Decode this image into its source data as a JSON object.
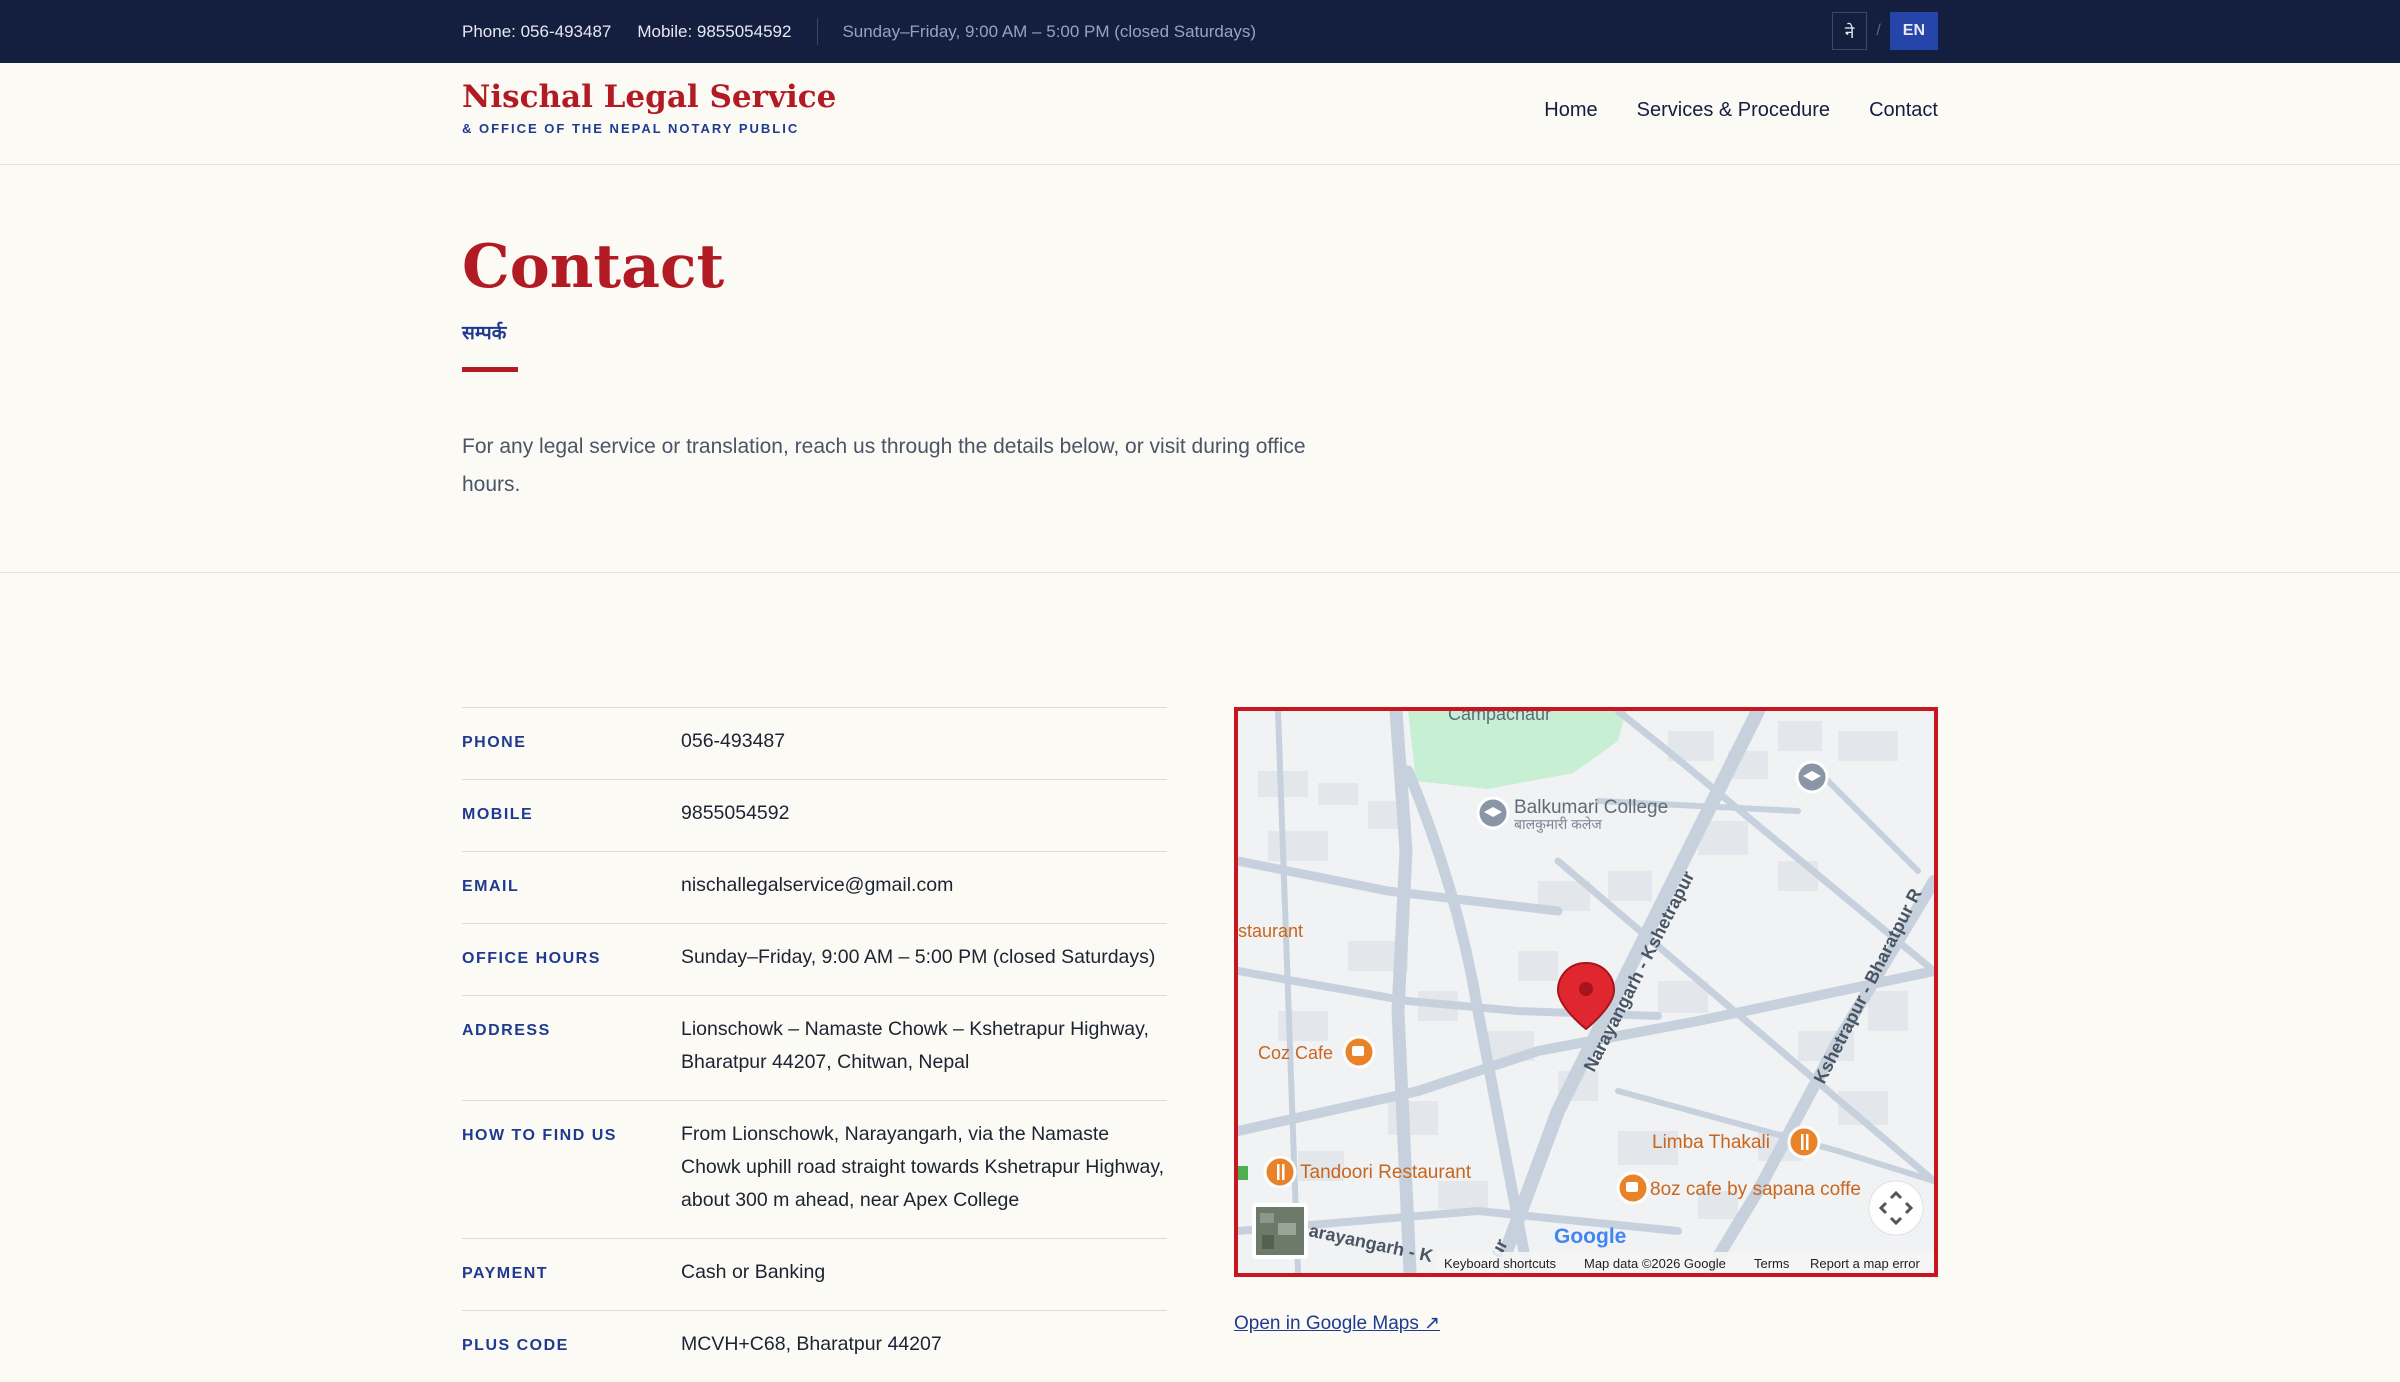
{
  "topbar": {
    "phone": "Phone: 056-493487",
    "mobile": "Mobile: 9855054592",
    "hours": "Sunday–Friday, 9:00 AM – 5:00 PM (closed Saturdays)",
    "lang_ne": "ने",
    "lang_sep": "/",
    "lang_en": "EN"
  },
  "header": {
    "brand_name": "Nischal Legal Service",
    "brand_sub": "& OFFICE OF THE NEPAL NOTARY PUBLIC",
    "nav": [
      "Home",
      "Services & Procedure",
      "Contact"
    ]
  },
  "hero": {
    "title": "Contact",
    "subtitle_ne": "सम्पर्क",
    "intro": "For any legal service or translation, reach us through the details below, or visit during office hours."
  },
  "details": [
    {
      "label": "PHONE",
      "value": "056-493487"
    },
    {
      "label": "MOBILE",
      "value": "9855054592"
    },
    {
      "label": "EMAIL",
      "value": "nischallegalservice@gmail.com"
    },
    {
      "label": "OFFICE HOURS",
      "value": "Sunday–Friday, 9:00 AM – 5:00 PM (closed Saturdays)"
    },
    {
      "label": "ADDRESS",
      "value": "Lionschowk – Namaste Chowk – Kshetrapur Highway, Bharatpur 44207, Chitwan, Nepal"
    },
    {
      "label": "HOW TO FIND US",
      "value": "From Lionschowk, Narayangarh, via the Namaste Chowk uphill road straight towards Kshetrapur Highway, about 300 m ahead, near Apex College"
    },
    {
      "label": "PAYMENT",
      "value": "Cash or Banking"
    },
    {
      "label": "PLUS CODE",
      "value": "MCVH+C68, Bharatpur 44207"
    }
  ],
  "map": {
    "labels": {
      "campachaur": "Campachaur",
      "college": "Balkumari College",
      "college_ne": "बालकुमारी कलेज",
      "restaurant_partial": "staurant",
      "coz": "Coz Cafe",
      "road1": "Narayangarh - Kshetrapur",
      "road2": "Kshetrapur - Bharatpur R",
      "limba": "Limba Thakali",
      "tandoori": "Tandoori Restaurant",
      "eightoz": "8oz cafe by sapana coffe",
      "road3": "arayangarh - K",
      "road3b": "ur",
      "google": "Google",
      "kbd": "Keyboard shortcuts",
      "mapdata": "Map data ©2026 Google",
      "terms": "Terms",
      "report": "Report a map error"
    },
    "icons": [
      "map-pin-icon",
      "school-icon",
      "restaurant-icon",
      "cafe-icon",
      "fullscreen-icon",
      "satellite-thumbnail"
    ],
    "colors": {
      "pin": "#e0272f",
      "poi": "#e8832a",
      "road": "#c7d1dd",
      "park": "#c7efd4"
    },
    "link": "Open in Google Maps ↗"
  }
}
